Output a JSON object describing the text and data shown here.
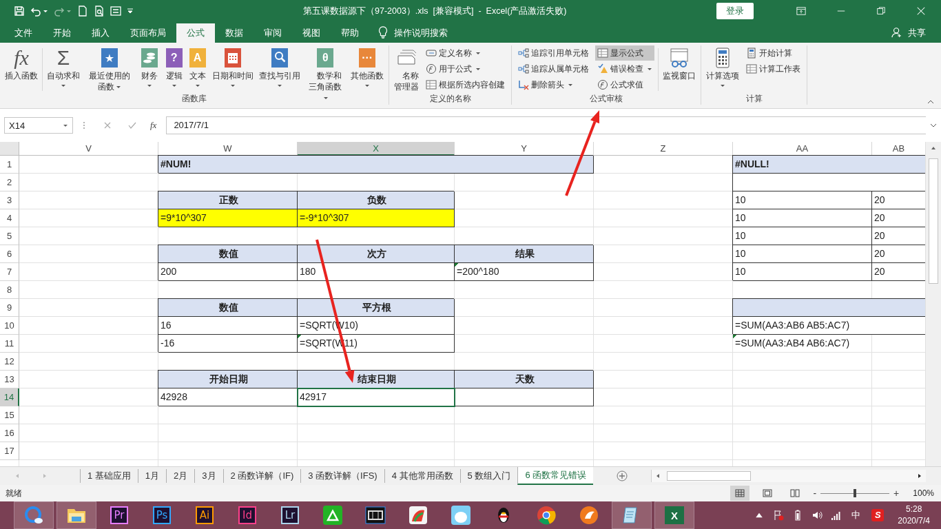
{
  "title_bar": {
    "title": "第五课数据源下（97-2003）.xls  [兼容模式]  -  Excel(产品激活失败)",
    "login": "登录"
  },
  "menu_tabs": [
    {
      "label": "文件",
      "selected": false
    },
    {
      "label": "开始",
      "selected": false
    },
    {
      "label": "插入",
      "selected": false
    },
    {
      "label": "页面布局",
      "selected": false
    },
    {
      "label": "公式",
      "selected": true
    },
    {
      "label": "数据",
      "selected": false
    },
    {
      "label": "审阅",
      "selected": false
    },
    {
      "label": "视图",
      "selected": false
    },
    {
      "label": "帮助",
      "selected": false
    }
  ],
  "tell_me": "操作说明搜索",
  "share": "共享",
  "ribbon": {
    "groups": [
      {
        "name": "函数库",
        "items": [
          {
            "kind": "big",
            "label": "插入函数",
            "icon": {
              "kind": "glyph",
              "glyph": "fx"
            },
            "dropdown": false
          },
          {
            "kind": "separator"
          },
          {
            "kind": "big",
            "label": "自动求和",
            "icon": {
              "kind": "glyph",
              "glyph": "Σ"
            },
            "dropdown": true
          },
          {
            "kind": "big",
            "label": "最近使用的函数",
            "icon": {
              "kind": "glyph-book",
              "color": "#3f7cc2",
              "glyph": "★"
            },
            "dropdown": true
          },
          {
            "kind": "big",
            "label": "财务",
            "icon": {
              "kind": "coins-book",
              "color": "#6aa88e"
            },
            "dropdown": true
          },
          {
            "kind": "big",
            "label": "逻辑",
            "icon": {
              "kind": "glyph-book",
              "color": "#8c5fb8",
              "glyph": "?"
            },
            "dropdown": true
          },
          {
            "kind": "big",
            "label": "文本",
            "icon": {
              "kind": "glyph-book",
              "color": "#f0b13b",
              "glyph": "A"
            },
            "dropdown": true
          },
          {
            "kind": "big",
            "label": "日期和时间",
            "icon": {
              "kind": "calendar-book",
              "color": "#d9533c"
            },
            "dropdown": true
          },
          {
            "kind": "big",
            "label": "查找与引用",
            "icon": {
              "kind": "magnifier-book",
              "color": "#3f7cc2"
            },
            "dropdown": true
          },
          {
            "kind": "big",
            "label": "数学和三角函数",
            "icon": {
              "kind": "glyph-book",
              "color": "#6aa88e",
              "glyph": "θ"
            },
            "dropdown": true
          },
          {
            "kind": "big",
            "label": "其他函数",
            "icon": {
              "kind": "glyph-book",
              "color": "#e8873a",
              "glyph": "···"
            },
            "dropdown": true
          }
        ]
      },
      {
        "name": "定义的名称",
        "items": [
          {
            "kind": "big",
            "label": "名称管理器",
            "icon": {
              "kind": "tags"
            },
            "dropdown": false
          },
          {
            "kind": "stack",
            "items": [
              {
                "kind": "tag",
                "label": "定义名称",
                "dropdown": true,
                "selected": false
              },
              {
                "kind": "fx",
                "label": "用于公式",
                "dropdown": true,
                "selected": false
              },
              {
                "kind": "grid",
                "label": "根据所选内容创建",
                "dropdown": false,
                "selected": false
              }
            ]
          }
        ]
      },
      {
        "name": "公式审核",
        "items": [
          {
            "kind": "stack",
            "items": [
              {
                "kind": "trace",
                "label": "追踪引用单元格",
                "dropdown": false,
                "selected": false
              },
              {
                "kind": "trace",
                "label": "追踪从属单元格",
                "dropdown": false,
                "selected": false
              },
              {
                "kind": "remove",
                "label": "删除箭头",
                "dropdown": true,
                "selected": false
              }
            ]
          },
          {
            "kind": "stack",
            "items": [
              {
                "kind": "sheet",
                "label": "显示公式",
                "dropdown": false,
                "selected": true
              },
              {
                "kind": "warning",
                "label": "错误检查",
                "dropdown": true,
                "selected": false
              },
              {
                "kind": "fx",
                "label": "公式求值",
                "dropdown": false,
                "selected": false
              }
            ]
          },
          {
            "kind": "separator"
          },
          {
            "kind": "big",
            "label": "监视窗口",
            "icon": {
              "kind": "watch"
            },
            "dropdown": false
          }
        ]
      },
      {
        "name": "计算",
        "items": [
          {
            "kind": "big",
            "label": "计算选项",
            "icon": {
              "kind": "calculator"
            },
            "dropdown": true
          },
          {
            "kind": "stack",
            "items": [
              {
                "kind": "calc",
                "label": "开始计算",
                "dropdown": false,
                "selected": false
              },
              {
                "kind": "grid",
                "label": "计算工作表",
                "dropdown": false,
                "selected": false
              }
            ]
          }
        ]
      }
    ]
  },
  "formula_bar": {
    "name_box": "X14",
    "fx": "fx",
    "value": "2017/7/1"
  },
  "sheet": {
    "columns": [
      {
        "label": "V",
        "selected": false
      },
      {
        "label": "W",
        "selected": false
      },
      {
        "label": "X",
        "selected": true
      },
      {
        "label": "Y",
        "selected": false
      },
      {
        "label": "Z",
        "selected": false
      },
      {
        "label": "AA",
        "selected": false
      },
      {
        "label": "AB",
        "selected": false
      }
    ],
    "rows": [
      {
        "header": "1",
        "selected": false,
        "cells": [
          {
            "kind": "empty"
          },
          {
            "kind": "band",
            "text": "#NUM!"
          },
          {
            "joined": true
          },
          {
            "joined": true
          },
          {
            "kind": "empty"
          },
          {
            "kind": "band",
            "text": "#NULL!"
          },
          {
            "joined": true
          }
        ]
      },
      {
        "header": "2",
        "selected": false,
        "cells": [
          {
            "kind": "empty"
          },
          {
            "kind": "empty"
          },
          {
            "kind": "empty"
          },
          {
            "kind": "empty"
          },
          {
            "kind": "empty"
          },
          {
            "kind": "value"
          },
          {
            "joined": true
          }
        ]
      },
      {
        "header": "3",
        "selected": false,
        "cells": [
          {
            "kind": "empty"
          },
          {
            "kind": "head",
            "text": "正数"
          },
          {
            "kind": "head",
            "text": "负数"
          },
          {
            "kind": "empty"
          },
          {
            "kind": "empty"
          },
          {
            "kind": "value",
            "text": "10"
          },
          {
            "kind": "value",
            "text": "20"
          }
        ]
      },
      {
        "header": "4",
        "selected": false,
        "cells": [
          {
            "kind": "empty"
          },
          {
            "kind": "yellow",
            "text": "=9*10^307"
          },
          {
            "kind": "yellow",
            "text": "=-9*10^307"
          },
          {
            "kind": "empty"
          },
          {
            "kind": "empty"
          },
          {
            "kind": "value",
            "text": "10"
          },
          {
            "kind": "value",
            "text": "20"
          }
        ]
      },
      {
        "header": "5",
        "selected": false,
        "cells": [
          {
            "kind": "empty"
          },
          {
            "kind": "empty"
          },
          {
            "kind": "empty"
          },
          {
            "kind": "empty"
          },
          {
            "kind": "empty"
          },
          {
            "kind": "value",
            "text": "10"
          },
          {
            "kind": "value",
            "text": "20"
          }
        ]
      },
      {
        "header": "6",
        "selected": false,
        "cells": [
          {
            "kind": "empty"
          },
          {
            "kind": "head",
            "text": "数值"
          },
          {
            "kind": "head",
            "text": "次方"
          },
          {
            "kind": "head",
            "text": "结果"
          },
          {
            "kind": "empty"
          },
          {
            "kind": "value",
            "text": "10"
          },
          {
            "kind": "value",
            "text": "20"
          }
        ]
      },
      {
        "header": "7",
        "selected": false,
        "cells": [
          {
            "kind": "empty"
          },
          {
            "kind": "value",
            "text": "200"
          },
          {
            "kind": "value",
            "text": "180"
          },
          {
            "kind": "value",
            "text": "=200^180",
            "marker": true
          },
          {
            "kind": "empty"
          },
          {
            "kind": "value",
            "text": "10"
          },
          {
            "kind": "value",
            "text": "20"
          }
        ]
      },
      {
        "header": "8",
        "selected": false
      },
      {
        "header": "9",
        "selected": false,
        "cells": [
          {
            "kind": "empty"
          },
          {
            "kind": "head",
            "text": "数值"
          },
          {
            "kind": "head",
            "text": "平方根"
          },
          {
            "kind": "empty"
          },
          {
            "kind": "empty"
          },
          {
            "kind": "band"
          },
          {
            "joined": true
          }
        ]
      },
      {
        "header": "10",
        "selected": false,
        "cells": [
          {
            "kind": "empty"
          },
          {
            "kind": "value",
            "text": "16"
          },
          {
            "kind": "value",
            "text": "=SQRT(W10)"
          },
          {
            "kind": "empty"
          },
          {
            "kind": "empty"
          },
          {
            "kind": "value",
            "text": "=SUM(AA3:AB6 AB5:AC7)"
          },
          {
            "joined": true
          }
        ]
      },
      {
        "header": "11",
        "selected": false,
        "cells": [
          {
            "kind": "empty"
          },
          {
            "kind": "value",
            "text": "-16"
          },
          {
            "kind": "value",
            "text": "=SQRT(W11)",
            "marker": true
          },
          {
            "kind": "empty"
          },
          {
            "kind": "empty"
          },
          {
            "kind": "plain",
            "text": "=SUM(AA3:AB4 AB6:AC7)",
            "marker": true
          },
          {
            "kind": "empty"
          }
        ]
      },
      {
        "header": "12",
        "selected": false
      },
      {
        "header": "13",
        "selected": false,
        "cells": [
          {
            "kind": "empty"
          },
          {
            "kind": "head",
            "text": "开始日期"
          },
          {
            "kind": "head",
            "text": "结束日期"
          },
          {
            "kind": "head",
            "text": "天数"
          },
          {
            "kind": "empty"
          },
          {
            "kind": "empty"
          },
          {
            "kind": "empty"
          }
        ]
      },
      {
        "header": "14",
        "selected": true,
        "cells": [
          {
            "kind": "empty"
          },
          {
            "kind": "value",
            "text": "42928"
          },
          {
            "kind": "value",
            "text": "42917",
            "selected": true
          },
          {
            "kind": "value"
          },
          {
            "kind": "empty"
          },
          {
            "kind": "empty"
          },
          {
            "kind": "empty"
          }
        ]
      },
      {
        "header": "15",
        "selected": false
      },
      {
        "header": "16",
        "selected": false
      },
      {
        "header": "17",
        "selected": false
      }
    ]
  },
  "sheet_tabs": [
    {
      "label": "1 基础应用",
      "selected": false
    },
    {
      "label": "1月",
      "selected": false
    },
    {
      "label": "2月",
      "selected": false
    },
    {
      "label": "3月",
      "selected": false
    },
    {
      "label": "2 函数详解（IF)",
      "selected": false
    },
    {
      "label": "3 函数详解（IFS)",
      "selected": false
    },
    {
      "label": "4 其他常用函数",
      "selected": false
    },
    {
      "label": "5 数组入门",
      "selected": false
    },
    {
      "label": "6 函数常见错误",
      "selected": true
    }
  ],
  "status_bar": {
    "status": "就绪",
    "views": [
      {
        "kind": "normal",
        "selected": true
      },
      {
        "kind": "page-layout",
        "selected": false
      },
      {
        "kind": "page-break",
        "selected": false
      }
    ],
    "zoom": {
      "minus": "-",
      "plus": "+",
      "level": 0.5,
      "percent": "100%"
    }
  },
  "taskbar": {
    "apps": [
      {
        "kind": "browser",
        "open": true
      },
      {
        "kind": "folder",
        "open": true
      },
      {
        "kind": "adobe",
        "label": "Pr",
        "color": "#e77dff",
        "open": false
      },
      {
        "kind": "adobe",
        "label": "Ps",
        "color": "#31a8ff",
        "open": false
      },
      {
        "kind": "adobe",
        "label": "Ai",
        "color": "#ff9a00",
        "open": false
      },
      {
        "kind": "adobe",
        "label": "Id",
        "color": "#ff3f8a",
        "open": false
      },
      {
        "kind": "adobe",
        "label": "Lr",
        "color": "#add5ec",
        "open": false
      },
      {
        "kind": "green-app",
        "open": false
      },
      {
        "kind": "video",
        "open": false
      },
      {
        "kind": "red-app",
        "open": false
      },
      {
        "kind": "blue-app",
        "open": false
      },
      {
        "kind": "penguin",
        "open": false
      },
      {
        "kind": "chrome",
        "open": false
      },
      {
        "kind": "orange-app",
        "open": false
      },
      {
        "kind": "notepad",
        "open": true
      },
      {
        "kind": "excel",
        "label": "X",
        "open": true
      }
    ],
    "ime": "中",
    "sogou": "S",
    "time": "5:28",
    "date": "2020/7/4"
  }
}
